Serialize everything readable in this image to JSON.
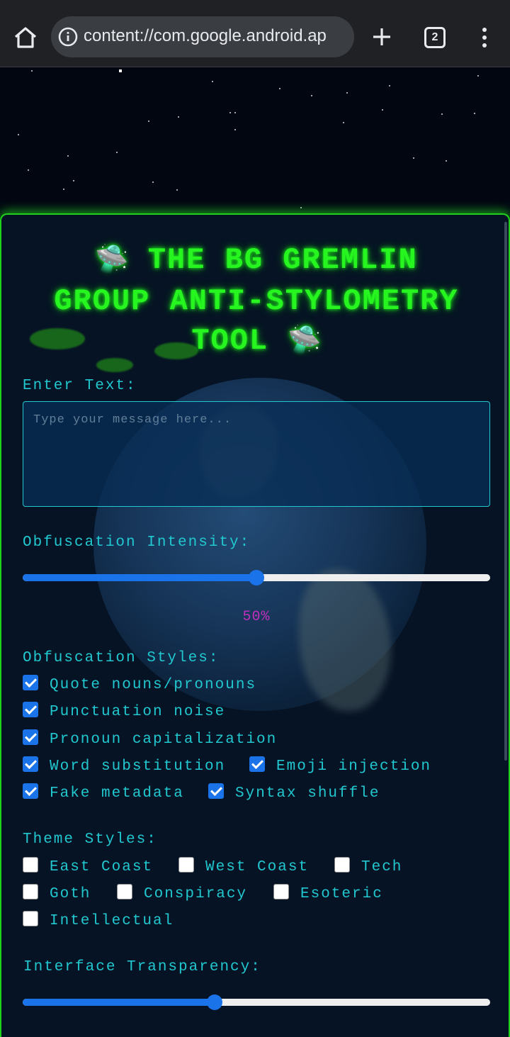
{
  "browser": {
    "url": "content://com.google.android.ap",
    "tab_count": "2"
  },
  "app": {
    "title_line1": "THE BG GREMLIN",
    "title_line2": "GROUP ANTI-STYLOMETRY",
    "title_line3": "TOOL",
    "ufo_glyph": "🛸"
  },
  "input": {
    "label": "Enter Text:",
    "placeholder": "Type your message here..."
  },
  "intensity": {
    "label": "Obfuscation Intensity:",
    "value_percent": 50,
    "value_text": "50%"
  },
  "styles": {
    "label": "Obfuscation Styles:",
    "options": [
      {
        "label": "Quote nouns/pronouns",
        "checked": true
      },
      {
        "label": "Punctuation noise",
        "checked": true
      },
      {
        "label": "Pronoun capitalization",
        "checked": true
      },
      {
        "label": "Word substitution",
        "checked": true
      },
      {
        "label": "Emoji injection",
        "checked": true
      },
      {
        "label": "Fake metadata",
        "checked": true
      },
      {
        "label": "Syntax shuffle",
        "checked": true
      }
    ]
  },
  "themes": {
    "label": "Theme Styles:",
    "options": [
      {
        "label": "East Coast",
        "checked": false
      },
      {
        "label": "West Coast",
        "checked": false
      },
      {
        "label": "Tech",
        "checked": false
      },
      {
        "label": "Goth",
        "checked": false
      },
      {
        "label": "Conspiracy",
        "checked": false
      },
      {
        "label": "Esoteric",
        "checked": false
      },
      {
        "label": "Intellectual",
        "checked": false
      }
    ]
  },
  "transparency": {
    "label": "Interface Transparency:",
    "value_percent": 41
  },
  "colors": {
    "accent_green": "#27f51f",
    "accent_cyan": "#21c8cf",
    "accent_magenta": "#c02fbf",
    "control_blue": "#1a73e8"
  }
}
